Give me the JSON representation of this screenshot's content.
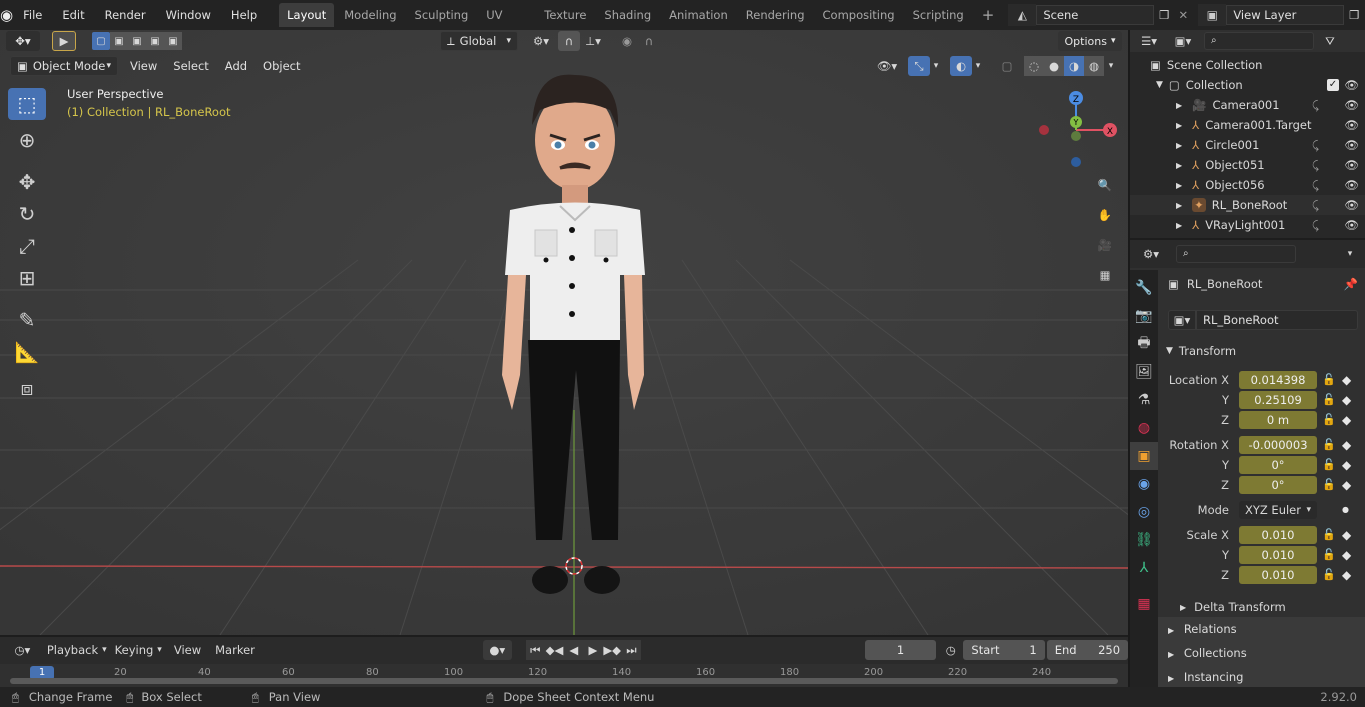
{
  "topbar": {
    "menus": [
      "File",
      "Edit",
      "Render",
      "Window",
      "Help"
    ],
    "workspaces": [
      "Layout",
      "Modeling",
      "Sculpting",
      "UV Editing",
      "Texture Paint",
      "Shading",
      "Animation",
      "Rendering",
      "Compositing",
      "Scripting"
    ],
    "active_workspace": "Layout",
    "add_tab": "+",
    "scene": "Scene",
    "view_layer": "View Layer"
  },
  "viewport": {
    "transform_orientation": "Global",
    "options": "Options",
    "mode": "Object Mode",
    "menus": [
      "View",
      "Select",
      "Add",
      "Object"
    ],
    "overlay_title": "User Perspective",
    "overlay_sub": "(1) Collection | RL_BoneRoot",
    "gizmo": {
      "x": "X",
      "y": "Y",
      "z": "Z"
    }
  },
  "outliner": {
    "scene_collection": "Scene Collection",
    "collection": "Collection",
    "items": [
      {
        "name": "Camera001",
        "icon": "camera-icon"
      },
      {
        "name": "Camera001.Target",
        "icon": "empty-icon"
      },
      {
        "name": "Circle001",
        "icon": "empty-icon"
      },
      {
        "name": "Object051",
        "icon": "empty-icon"
      },
      {
        "name": "Object056",
        "icon": "empty-icon"
      },
      {
        "name": "RL_BoneRoot",
        "icon": "armature-icon"
      },
      {
        "name": "VRayLight001",
        "icon": "empty-icon"
      }
    ]
  },
  "properties": {
    "object_name": "RL_BoneRoot",
    "datablock": "RL_BoneRoot",
    "transform_title": "Transform",
    "location": {
      "label": "Location X",
      "x": "0.014398",
      "y": "0.25109",
      "z": "0 m"
    },
    "rotation": {
      "label": "Rotation X",
      "x": "-0.000003",
      "y": "0°",
      "z": "0°"
    },
    "mode_label": "Mode",
    "mode_value": "XYZ Euler",
    "scale": {
      "label": "Scale X",
      "x": "0.010",
      "y": "0.010",
      "z": "0.010"
    },
    "axis_y": "Y",
    "axis_z": "Z",
    "delta": "Delta Transform",
    "panels": [
      "Relations",
      "Collections",
      "Instancing"
    ]
  },
  "timeline": {
    "menus": [
      "Playback",
      "Keying",
      "View",
      "Marker"
    ],
    "current_frame": "1",
    "start_label": "Start",
    "start": "1",
    "end_label": "End",
    "end": "250",
    "ruler": [
      "1",
      "20",
      "40",
      "60",
      "80",
      "100",
      "120",
      "140",
      "160",
      "180",
      "200",
      "220",
      "240"
    ]
  },
  "statusbar": {
    "change_frame": "Change Frame",
    "box_select": "Box Select",
    "pan_view": "Pan View",
    "context_menu": "Dope Sheet Context Menu",
    "version": "2.92.0"
  },
  "colors": {
    "accent": "#4772b3",
    "field_anim": "#7e7a33",
    "active_text": "#d6c64b",
    "x_axis": "#e05263",
    "y_axis": "#83be43",
    "z_axis": "#4b8ce3"
  }
}
